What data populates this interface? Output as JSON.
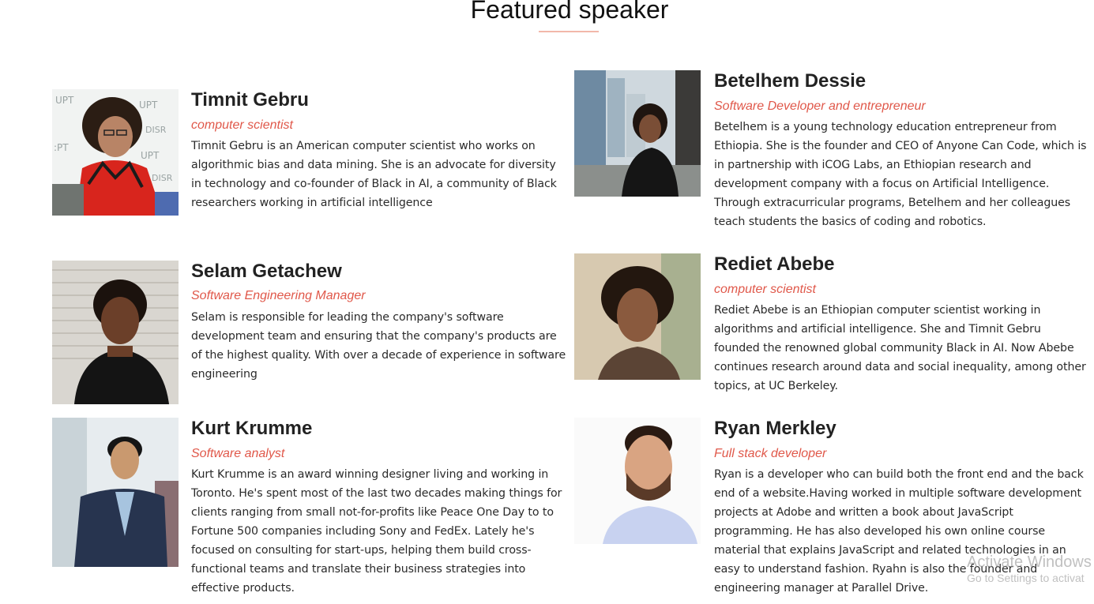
{
  "section": {
    "title": "Featured speaker"
  },
  "speakers": [
    {
      "name": "Timnit Gebru",
      "role": "computer scientist",
      "bio": "Timnit Gebru is an American computer scientist who works on algorithmic bias and data mining. She is an advocate for diversity in technology and co-founder of Black in AI, a community of Black researchers working in artificial intelligence"
    },
    {
      "name": "Betelhem Dessie",
      "role": "Software Developer and entrepreneur",
      "bio": "Betelhem is a young technology education entrepreneur from Ethiopia. She is the founder and CEO of Anyone Can Code, which is in partnership with iCOG Labs, an Ethiopian research and development company with a focus on Artificial Intelligence. Through extracurricular programs, Betelhem and her colleagues teach students the basics of coding and robotics."
    },
    {
      "name": "Selam Getachew",
      "role": "Software Engineering Manager",
      "bio": "Selam is responsible for leading the company's software development team and ensuring that the company's products are of the highest quality. With over a decade of experience in software engineering"
    },
    {
      "name": "Rediet Abebe",
      "role": "computer scientist",
      "bio": "Rediet Abebe is an Ethiopian computer scientist working in algorithms and artificial intelligence. She and Timnit Gebru founded the renowned global community Black in AI. Now Abebe continues research around data and social inequality, among other topics, at UC Berkeley."
    },
    {
      "name": "Kurt Krumme",
      "role": "Software analyst",
      "bio": "Kurt Krumme is an award winning designer living and working in Toronto. He's spent most of the last two decades making things for clients ranging from small not-for-profits like Peace One Day to to Fortune 500 companies including Sony and FedEx. Lately he's focused on consulting for start-ups, helping them build cross-functional teams and translate their business strategies into effective products."
    },
    {
      "name": "Ryan Merkley",
      "role": "Full stack developer",
      "bio": "Ryan is a developer who can build both the front end and the back end of a website.Having worked in multiple software development projects at Adobe and written a book about JavaScript programming. He has also developed his own online course material that explains JavaScript and related technologies in an easy to understand fashion. Ryahn is also the founder and engineering manager at Parallel Drive."
    }
  ],
  "os_watermark": {
    "title": "Activate Windows",
    "subtitle": "Go to Settings to activat"
  },
  "colors": {
    "role_accent": "#e0584a",
    "underline": "#f2b8aa",
    "name_text": "#222222",
    "bio_text": "#2a2a2a"
  }
}
